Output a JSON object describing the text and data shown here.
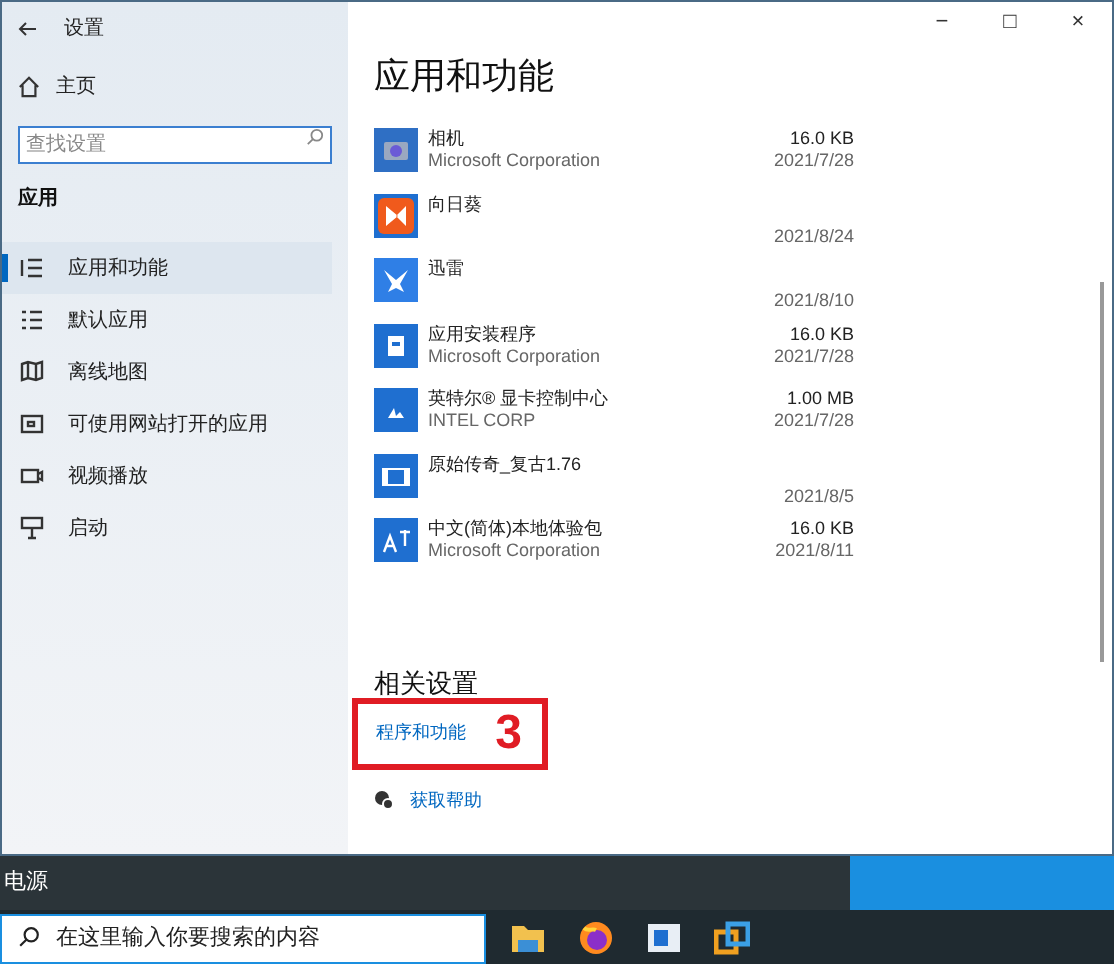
{
  "window": {
    "title": "设置",
    "controls": [
      "−",
      "□",
      "×"
    ]
  },
  "sidebar": {
    "home": "主页",
    "search": {
      "placeholder": "查找设置"
    },
    "section": "应用",
    "items": [
      {
        "label": "应用和功能",
        "kind": "list",
        "selected": true
      },
      {
        "label": "默认应用",
        "kind": "default",
        "selected": false
      },
      {
        "label": "离线地图",
        "kind": "map",
        "selected": false
      },
      {
        "label": "可使用网站打开的应用",
        "kind": "web",
        "selected": false
      },
      {
        "label": "视频播放",
        "kind": "video",
        "selected": false
      },
      {
        "label": "启动",
        "kind": "startup",
        "selected": false
      }
    ]
  },
  "main": {
    "title": "应用和功能",
    "apps": [
      {
        "name": "相机",
        "publisher": "Microsoft Corporation",
        "size": "16.0 KB",
        "date": "2021/7/28",
        "kind": "camera"
      },
      {
        "name": "向日葵",
        "date": "2021/8/24",
        "kind": "sunflower"
      },
      {
        "name": "迅雷",
        "date": "2021/8/10",
        "kind": "bird"
      },
      {
        "name": "应用安装程序",
        "publisher": "Microsoft Corporation",
        "size": "16.0 KB",
        "date": "2021/7/28",
        "kind": "box"
      },
      {
        "name": "英特尔® 显卡控制中心",
        "publisher": "INTEL CORP",
        "size": "1.00 MB",
        "date": "2021/7/28",
        "kind": "intel"
      },
      {
        "name": "原始传奇_复古1.76",
        "date": "2021/8/5",
        "kind": "film"
      },
      {
        "name": "中文(简体)本地体验包",
        "publisher": "Microsoft Corporation",
        "size": "16.0 KB",
        "date": "2021/8/11",
        "kind": "lang"
      }
    ],
    "related": {
      "heading": "相关设置",
      "link": "程序和功能",
      "annotation": "3"
    },
    "help": "获取帮助"
  },
  "start_menu": {
    "power": "电源"
  },
  "taskbar": {
    "search": {
      "placeholder": "在这里输入你要搜索的内容"
    },
    "apps": [
      {
        "kind": "folder"
      },
      {
        "kind": "browser"
      },
      {
        "kind": "window"
      },
      {
        "kind": "squares"
      }
    ]
  }
}
